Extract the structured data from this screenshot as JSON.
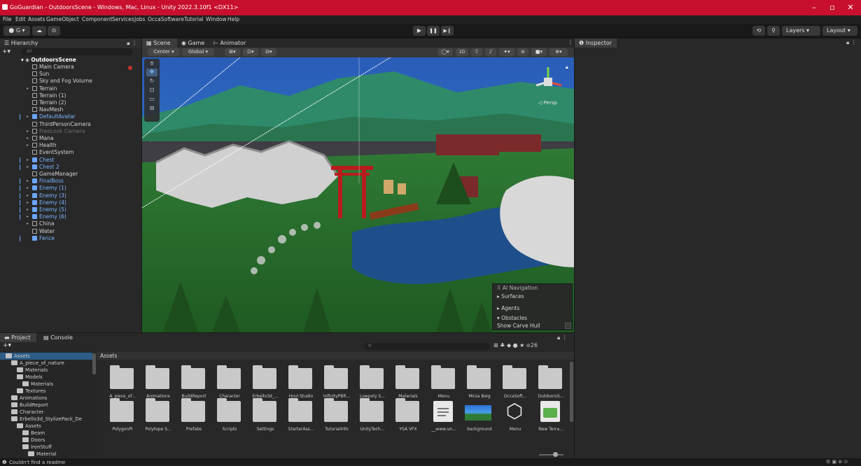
{
  "window": {
    "title": "GoGuardian - OutdoorsScene - Windows, Mac, Linux - Unity 2022.3.10f1 <DX11>",
    "minimize": "–",
    "maximize": "▫",
    "close": "✕"
  },
  "menu": [
    "File",
    "Edit",
    "Assets",
    "GameObject",
    "Component",
    "Services",
    "Jobs",
    "OccaSoftware",
    "Tutorial",
    "Window",
    "Help"
  ],
  "toolbar": {
    "account": "G ▾",
    "play": "▶",
    "pause": "❚❚",
    "step": "▶❙",
    "layers": "Layers",
    "layout": "Layout"
  },
  "hierarchy": {
    "tab": "Hierarchy",
    "search_placeholder": "All",
    "scene": "OutdoorsScene",
    "items": [
      {
        "label": "Main Camera",
        "style": "normal",
        "arrow": false
      },
      {
        "label": "Sun",
        "style": "normal",
        "arrow": false
      },
      {
        "label": "Sky and Fog Volume",
        "style": "normal",
        "arrow": false
      },
      {
        "label": "Terrain",
        "style": "normal",
        "arrow": true
      },
      {
        "label": "Terrain (1)",
        "style": "normal",
        "arrow": false
      },
      {
        "label": "Terrain (2)",
        "style": "normal",
        "arrow": false
      },
      {
        "label": "NavMesh",
        "style": "normal",
        "arrow": false
      },
      {
        "label": "DefaultAvatar",
        "style": "blue",
        "arrow": true
      },
      {
        "label": "ThirdPersonCamera",
        "style": "normal",
        "arrow": false
      },
      {
        "label": "FreeLook Camera",
        "style": "dim",
        "arrow": true
      },
      {
        "label": "Mana",
        "style": "normal",
        "arrow": true
      },
      {
        "label": "Health",
        "style": "normal",
        "arrow": true
      },
      {
        "label": "EventSystem",
        "style": "normal",
        "arrow": false
      },
      {
        "label": "Chest",
        "style": "blue",
        "arrow": true
      },
      {
        "label": "Chest 2",
        "style": "blue",
        "arrow": true
      },
      {
        "label": "GameManager",
        "style": "normal",
        "arrow": false
      },
      {
        "label": "FinalBoss",
        "style": "blue",
        "arrow": true
      },
      {
        "label": "Enemy (1)",
        "style": "blue",
        "arrow": true
      },
      {
        "label": "Enemy (3)",
        "style": "blue",
        "arrow": true
      },
      {
        "label": "Enemy (4)",
        "style": "blue",
        "arrow": true
      },
      {
        "label": "Enemy (5)",
        "style": "blue",
        "arrow": true
      },
      {
        "label": "Enemy (6)",
        "style": "blue",
        "arrow": true
      },
      {
        "label": "China",
        "style": "normal",
        "arrow": true
      },
      {
        "label": "Water",
        "style": "normal",
        "arrow": false
      },
      {
        "label": "Fence",
        "style": "blue",
        "arrow": false
      }
    ]
  },
  "scene_tabs": [
    {
      "label": "Scene"
    },
    {
      "label": "Game"
    },
    {
      "label": "Animator"
    }
  ],
  "scene_toolbar": {
    "center": "Center ▾",
    "global": "Global ▾",
    "mode_2d": "2D"
  },
  "gizmo": {
    "persp": "◁ Persp"
  },
  "ai_nav": {
    "title": "AI Navigation",
    "surfaces": "Surfaces",
    "agents": "Agents",
    "obstacles": "Obstacles",
    "show_carve_hull": "Show Carve Hull"
  },
  "inspector": {
    "tab": "Inspector"
  },
  "project": {
    "tab_project": "Project",
    "tab_console": "Console",
    "breadcrumb": "Assets",
    "count": "26",
    "tree": [
      {
        "label": "Assets",
        "indent": 0
      },
      {
        "label": "A_piece_of_nature",
        "indent": 1
      },
      {
        "label": "Materials",
        "indent": 2
      },
      {
        "label": "Models",
        "indent": 2
      },
      {
        "label": "Materials",
        "indent": 3
      },
      {
        "label": "Textures",
        "indent": 2
      },
      {
        "label": "Animations",
        "indent": 1
      },
      {
        "label": "BuildReport",
        "indent": 1
      },
      {
        "label": "Character",
        "indent": 1
      },
      {
        "label": "Erbello3d_StylizePack_De",
        "indent": 1
      },
      {
        "label": "Assets",
        "indent": 2
      },
      {
        "label": "Beam",
        "indent": 3
      },
      {
        "label": "Doors",
        "indent": 3
      },
      {
        "label": "IronStuff",
        "indent": 3
      },
      {
        "label": "Material",
        "indent": 4
      }
    ],
    "assets_row1": [
      "A_piece_of...",
      "Animations",
      "BuildReport",
      "Character",
      "Erbello3d_...",
      "Hovl Studio",
      "InfinityPBR...",
      "Lowpoly S...",
      "Materials",
      "Menu",
      "Mirza Beig",
      "OccaSoft...",
      "OutdoorsS..."
    ],
    "assets_row2": [
      {
        "label": "PolygonPi",
        "kind": "folder"
      },
      {
        "label": "Polytope S...",
        "kind": "folder"
      },
      {
        "label": "Prefabs",
        "kind": "folder"
      },
      {
        "label": "Scripts",
        "kind": "folder"
      },
      {
        "label": "Settings",
        "kind": "folder"
      },
      {
        "label": "StarterAss...",
        "kind": "folder"
      },
      {
        "label": "TutorialInfo",
        "kind": "folder"
      },
      {
        "label": "UnityTech...",
        "kind": "folder"
      },
      {
        "label": "YSA VFX",
        "kind": "folder"
      },
      {
        "label": "__www.un...",
        "kind": "doc"
      },
      {
        "label": "background",
        "kind": "image"
      },
      {
        "label": "Menu",
        "kind": "unity"
      },
      {
        "label": "New Terra...",
        "kind": "terrain"
      }
    ]
  },
  "status": {
    "text": "Couldn't find a readme"
  },
  "colors": {
    "title_bar": "#c8102e",
    "panel": "#282828",
    "dark": "#191919",
    "selection_blue": "#7cb3ff"
  }
}
